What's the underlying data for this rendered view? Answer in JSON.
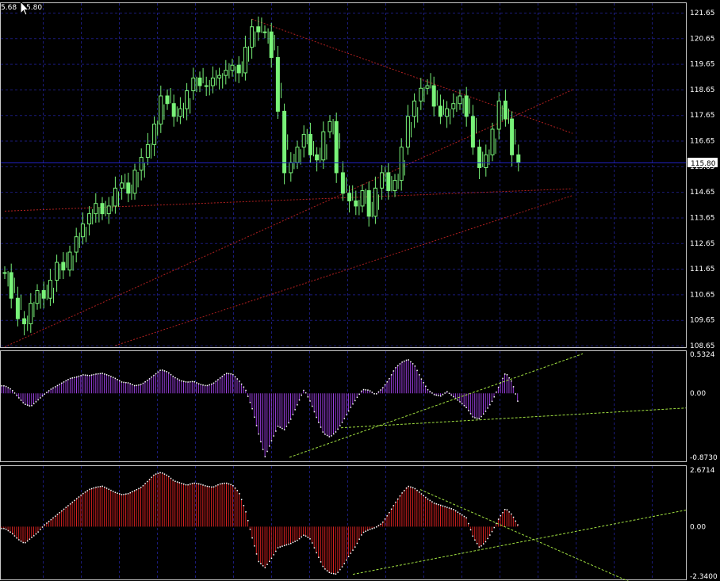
{
  "header": {
    "price_left": "5.68",
    "price_right": "5.80"
  },
  "colors": {
    "background": "#000000",
    "grid": "#1b1b7a",
    "border": "#c8c8c8",
    "candle": "#79f279",
    "trendline": "#b02020",
    "bid_line": "#2020c0",
    "macd_hist": "#9b3ee0",
    "osma_hist": "#d42020",
    "histogram_high": "#ffffff",
    "indicator_trendline": "#a0e040",
    "price_label_bg": "#ffffff",
    "price_label_fg": "#000000"
  },
  "chart_data": [
    {
      "type": "candlestick",
      "panel": "price",
      "y_ticks": [
        "121.65",
        "120.65",
        "119.65",
        "118.65",
        "117.65",
        "116.65",
        "115.65",
        "114.65",
        "113.65",
        "112.65",
        "111.65",
        "110.65",
        "109.65",
        "108.65"
      ],
      "ylim": [
        108.65,
        121.65
      ],
      "current_price": "115.80",
      "close_series": [
        111.5,
        110.5,
        109.7,
        109.5,
        110.3,
        110.8,
        110.5,
        111.2,
        111.9,
        111.6,
        112.3,
        112.9,
        113.4,
        113.8,
        114.2,
        113.8,
        114.1,
        114.8,
        115.0,
        114.6,
        115.5,
        116.0,
        116.5,
        117.3,
        118.4,
        118.1,
        117.6,
        117.9,
        118.6,
        119.1,
        118.8,
        118.8,
        119.1,
        119.2,
        119.4,
        119.6,
        119.3,
        120.3,
        121.1,
        120.9,
        120.9,
        119.9,
        117.8,
        115.4,
        115.8,
        116.4,
        116.9,
        116.1,
        115.9,
        117.0,
        117.4,
        115.4,
        114.6,
        114.3,
        114.1,
        114.7,
        113.7,
        114.8,
        115.4,
        114.7,
        115.1,
        116.4,
        117.6,
        118.2,
        118.7,
        118.8,
        118.0,
        117.6,
        117.9,
        118.1,
        118.4,
        117.6,
        116.4,
        115.6,
        116.1,
        117.1,
        118.2,
        117.5,
        116.1,
        115.8
      ],
      "series": [
        {
          "name": "",
          "kind": "trend",
          "from": [
            0,
            108.6
          ],
          "to": [
            80,
            117.8
          ]
        },
        {
          "name": "",
          "kind": "trend",
          "from": [
            38,
            121.4
          ],
          "to": [
            80,
            117.6
          ]
        },
        {
          "name": "",
          "kind": "trend",
          "from": [
            0,
            113.9
          ],
          "to": [
            80,
            114.7
          ]
        },
        {
          "name": "",
          "kind": "trend",
          "from": [
            17,
            108.65
          ],
          "to": [
            80,
            113.9
          ]
        }
      ]
    },
    {
      "type": "histogram",
      "panel": "macd",
      "y_ticks": [
        "0.5324",
        "0.00",
        "-0.8730"
      ],
      "ylim": [
        -0.873,
        0.5324
      ],
      "values": [
        0.1,
        0.05,
        -0.05,
        -0.15,
        -0.18,
        -0.1,
        -0.02,
        0.05,
        0.1,
        0.15,
        0.2,
        0.22,
        0.25,
        0.24,
        0.26,
        0.27,
        0.24,
        0.2,
        0.15,
        0.14,
        0.1,
        0.12,
        0.18,
        0.25,
        0.32,
        0.29,
        0.22,
        0.17,
        0.15,
        0.16,
        0.12,
        0.1,
        0.13,
        0.2,
        0.27,
        0.26,
        0.17,
        0.05,
        -0.2,
        -0.55,
        -0.87,
        -0.65,
        -0.45,
        -0.5,
        -0.35,
        -0.15,
        0.05,
        -0.12,
        -0.35,
        -0.55,
        -0.6,
        -0.52,
        -0.38,
        -0.22,
        -0.08,
        0.05,
        0.04,
        -0.02,
        0.06,
        0.18,
        0.34,
        0.42,
        0.46,
        0.38,
        0.2,
        0.05,
        -0.02,
        -0.04,
        0.02,
        -0.05,
        -0.12,
        -0.2,
        -0.33,
        -0.35,
        -0.24,
        -0.1,
        0.1,
        0.28,
        0.15,
        -0.15
      ]
    },
    {
      "type": "histogram",
      "panel": "osma",
      "y_ticks": [
        "2.6714",
        "0.00",
        "-2.3400"
      ],
      "ylim": [
        -2.34,
        2.6714
      ],
      "values": [
        -0.1,
        -0.3,
        -0.6,
        -0.8,
        -0.55,
        -0.3,
        0.05,
        0.3,
        0.55,
        0.8,
        1.05,
        1.3,
        1.55,
        1.75,
        1.85,
        1.9,
        1.75,
        1.6,
        1.5,
        1.55,
        1.7,
        1.85,
        2.15,
        2.45,
        2.55,
        2.4,
        2.15,
        2.05,
        1.95,
        2.05,
        2.0,
        1.9,
        1.85,
        2.0,
        2.05,
        1.95,
        1.6,
        0.75,
        -0.5,
        -1.65,
        -1.95,
        -1.5,
        -1.0,
        -0.9,
        -0.8,
        -0.65,
        -0.4,
        -0.6,
        -1.3,
        -1.95,
        -2.2,
        -2.25,
        -1.85,
        -1.35,
        -0.9,
        -0.3,
        -0.15,
        -0.05,
        0.15,
        0.6,
        1.1,
        1.55,
        1.9,
        1.8,
        1.55,
        1.3,
        1.1,
        1.0,
        0.9,
        0.8,
        0.6,
        0.4,
        -0.5,
        -1.0,
        -0.7,
        -0.2,
        0.4,
        0.85,
        0.55,
        0.0
      ]
    }
  ]
}
